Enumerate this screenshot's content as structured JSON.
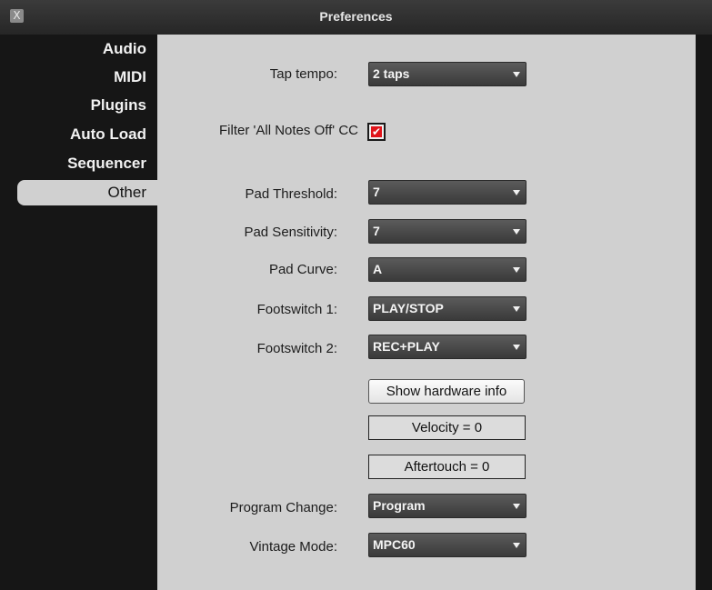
{
  "window": {
    "title": "Preferences",
    "close_glyph": "X"
  },
  "sidebar": {
    "items": [
      {
        "label": "Audio"
      },
      {
        "label": "MIDI"
      },
      {
        "label": "Plugins"
      },
      {
        "label": "Auto Load"
      },
      {
        "label": "Sequencer"
      },
      {
        "label": "Other",
        "selected": true
      }
    ]
  },
  "settings": {
    "tap_tempo": {
      "label": "Tap tempo:",
      "value": "2 taps"
    },
    "filter_all_notes_off": {
      "label": "Filter 'All Notes Off' CC",
      "checked": true,
      "check_glyph": "✔"
    },
    "pad_threshold": {
      "label": "Pad Threshold:",
      "value": "7"
    },
    "pad_sensitivity": {
      "label": "Pad Sensitivity:",
      "value": "7"
    },
    "pad_curve": {
      "label": "Pad Curve:",
      "value": "A"
    },
    "footswitch_1": {
      "label": "Footswitch 1:",
      "value": "PLAY/STOP"
    },
    "footswitch_2": {
      "label": "Footswitch 2:",
      "value": "REC+PLAY"
    },
    "show_hardware_info": {
      "label": "Show hardware info"
    },
    "velocity": {
      "text": "Velocity = 0"
    },
    "aftertouch": {
      "text": "Aftertouch = 0"
    },
    "program_change": {
      "label": "Program Change:",
      "value": "Program"
    },
    "vintage_mode": {
      "label": "Vintage Mode:",
      "value": "MPC60"
    }
  },
  "colors": {
    "panel_bg": "#d0d0d0",
    "sidebar_bg": "#161616",
    "checkbox_accent": "#e0151b"
  }
}
